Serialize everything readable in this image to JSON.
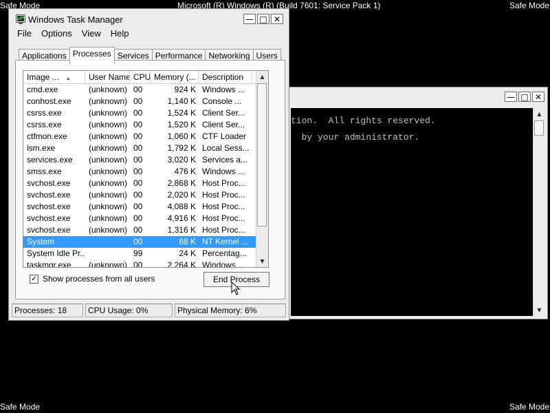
{
  "desktop": {
    "top_left": "Safe Mode",
    "top_center": "Microsoft (R) Windows (R) (Build 7601: Service Pack 1)",
    "top_right": "Safe Mode",
    "bottom_left": "Safe Mode",
    "bottom_right": "Safe Mode"
  },
  "console": {
    "line1": "tion.  All rights reserved.",
    "line2": "  by your administrator."
  },
  "taskmgr": {
    "title": "Windows Task Manager",
    "menu": [
      "File",
      "Options",
      "View",
      "Help"
    ],
    "tabs": [
      "Applications",
      "Processes",
      "Services",
      "Performance",
      "Networking",
      "Users"
    ],
    "active_tab": "Processes",
    "columns": {
      "name": "Image ...",
      "user": "User Name",
      "cpu": "CPU",
      "memory": "Memory (...",
      "description": "Description"
    },
    "rows": [
      {
        "name": "cmd.exe",
        "user": "(unknown)",
        "cpu": "00",
        "memory": "924 K",
        "description": "Windows ..."
      },
      {
        "name": "conhost.exe",
        "user": "(unknown)",
        "cpu": "00",
        "memory": "1,140 K",
        "description": "Console ..."
      },
      {
        "name": "csrss.exe",
        "user": "(unknown)",
        "cpu": "00",
        "memory": "1,524 K",
        "description": "Client Ser..."
      },
      {
        "name": "csrss.exe",
        "user": "(unknown)",
        "cpu": "00",
        "memory": "1,520 K",
        "description": "Client Ser..."
      },
      {
        "name": "ctfmon.exe",
        "user": "(unknown)",
        "cpu": "00",
        "memory": "1,060 K",
        "description": "CTF Loader"
      },
      {
        "name": "lsm.exe",
        "user": "(unknown)",
        "cpu": "00",
        "memory": "1,792 K",
        "description": "Local Sess..."
      },
      {
        "name": "services.exe",
        "user": "(unknown)",
        "cpu": "00",
        "memory": "3,020 K",
        "description": "Services a..."
      },
      {
        "name": "smss.exe",
        "user": "(unknown)",
        "cpu": "00",
        "memory": "476 K",
        "description": "Windows ..."
      },
      {
        "name": "svchost.exe",
        "user": "(unknown)",
        "cpu": "00",
        "memory": "2,868 K",
        "description": "Host Proc..."
      },
      {
        "name": "svchost.exe",
        "user": "(unknown)",
        "cpu": "00",
        "memory": "2,020 K",
        "description": "Host Proc..."
      },
      {
        "name": "svchost.exe",
        "user": "(unknown)",
        "cpu": "00",
        "memory": "4,088 K",
        "description": "Host Proc..."
      },
      {
        "name": "svchost.exe",
        "user": "(unknown)",
        "cpu": "00",
        "memory": "4,916 K",
        "description": "Host Proc..."
      },
      {
        "name": "svchost.exe",
        "user": "(unknown)",
        "cpu": "00",
        "memory": "1,316 K",
        "description": "Host Proc..."
      },
      {
        "name": "System",
        "user": "",
        "cpu": "00",
        "memory": "68 K",
        "description": "NT Kernel ...",
        "selected": true
      },
      {
        "name": "System Idle Pr...",
        "user": "",
        "cpu": "99",
        "memory": "24 K",
        "description": "Percentag..."
      },
      {
        "name": "taskmgr.exe",
        "user": "(unknown)",
        "cpu": "00",
        "memory": "2,264 K",
        "description": "Windows ..."
      }
    ],
    "show_all_label": "Show processes from all users",
    "show_all_checked": true,
    "end_process_label": "End Process",
    "status": {
      "processes": "Processes: 18",
      "cpu": "CPU Usage: 0%",
      "memory": "Physical Memory: 6%"
    }
  },
  "colors": {
    "selection": "#3399ff",
    "desktop": "#000000"
  }
}
